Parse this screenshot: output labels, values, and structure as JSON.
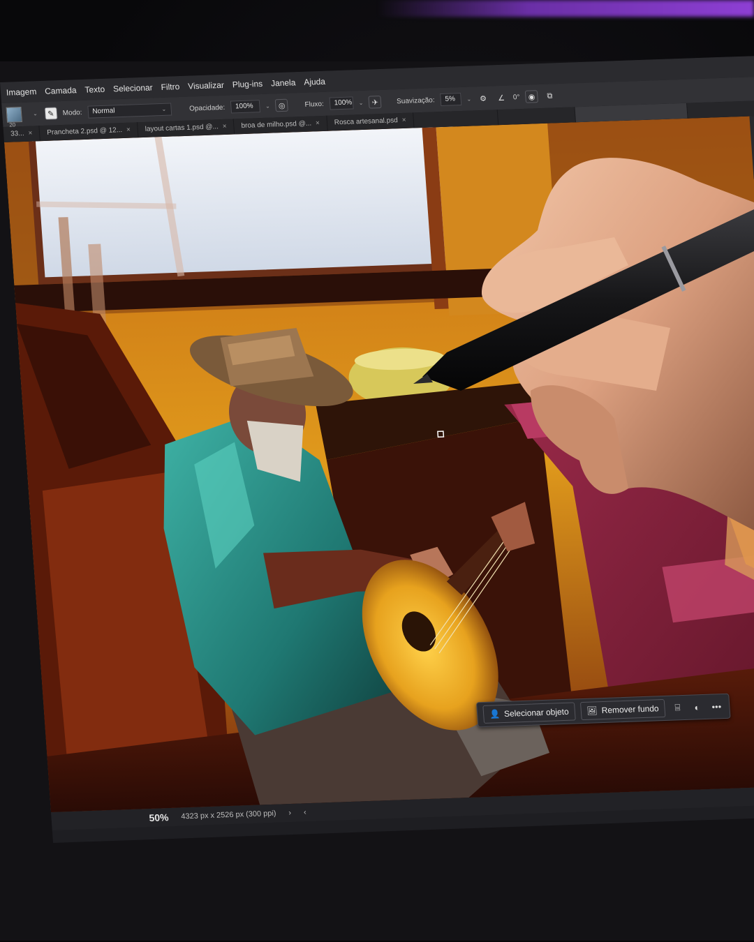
{
  "menu": {
    "items": [
      "Imagem",
      "Camada",
      "Texto",
      "Selecionar",
      "Filtro",
      "Visualizar",
      "Plug-ins",
      "Janela",
      "Ajuda"
    ]
  },
  "options": {
    "brush_size": "20",
    "mode_label": "Modo:",
    "mode_value": "Normal",
    "opacity_label": "Opacidade:",
    "opacity_value": "100%",
    "flow_label": "Fluxo:",
    "flow_value": "100%",
    "smoothing_label": "Suavização:",
    "smoothing_value": "5%"
  },
  "tabs": [
    {
      "label": "33...",
      "close": "×"
    },
    {
      "label": "Prancheta 2.psd @ 12...",
      "close": "×"
    },
    {
      "label": "layout cartas 1.psd @...",
      "close": "×"
    },
    {
      "label": "broa de milho.psd @...",
      "close": "×"
    },
    {
      "label": "Rosca artesanal.psd",
      "close": "×"
    }
  ],
  "context_bar": {
    "select_subject": "Selecionar objeto",
    "remove_background": "Remover fundo",
    "more": "•••"
  },
  "status": {
    "zoom": "50%",
    "dimensions": "4323 px x 2526 px (300 ppi)"
  },
  "icons": {
    "brush": "brush-icon",
    "pressure_opacity": "pressure-opacity-icon",
    "airbrush": "airbrush-icon",
    "smoothing_settings": "gear-icon",
    "angle": "angle-icon",
    "pressure_size": "pressure-size-icon",
    "symmetry": "symmetry-icon",
    "person": "person-icon",
    "image": "image-icon",
    "transform": "transform-icon",
    "mask": "mask-icon"
  }
}
